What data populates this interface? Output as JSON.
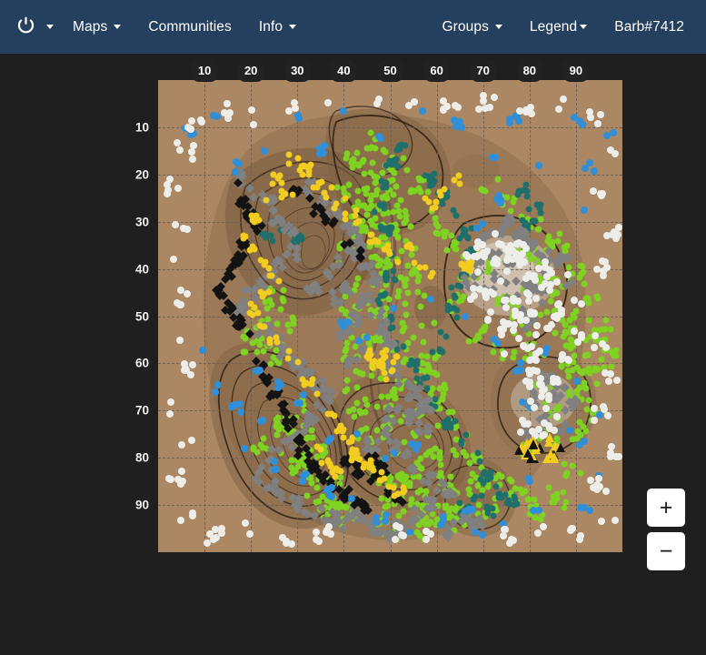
{
  "navbar": {
    "brand": {
      "icon": "ark-power-logo-icon",
      "caret_icon": "caret-down-icon"
    },
    "left_items": [
      {
        "label": "Maps",
        "has_caret": true,
        "name": "nav-maps"
      },
      {
        "label": "Communities",
        "has_caret": false,
        "name": "nav-communities"
      },
      {
        "label": "Info",
        "has_caret": true,
        "name": "nav-info"
      }
    ],
    "right_items": [
      {
        "label": "Groups",
        "has_caret": true,
        "name": "nav-groups"
      },
      {
        "label": "Legend",
        "has_caret": true,
        "name": "nav-legend"
      },
      {
        "label": "Barb#7412",
        "has_caret": false,
        "name": "nav-user"
      }
    ],
    "background_color": "#25405f",
    "text_color": "#ffffff"
  },
  "map": {
    "name": "resource-map",
    "background_color": "#1f1f1f",
    "surface_color": "#ab8763",
    "grid_color": "#6f6155",
    "x_labels": [
      "10",
      "20",
      "30",
      "40",
      "50",
      "60",
      "70",
      "80",
      "90"
    ],
    "y_labels": [
      "10",
      "20",
      "30",
      "40",
      "50",
      "60",
      "70",
      "80",
      "90"
    ],
    "axis_min": 0,
    "axis_max": 100,
    "marker_colors": {
      "wood_green": "#7ed321",
      "forest_teal": "#1f6f6b",
      "metal_gray": "#808080",
      "stone_white": "#ededea",
      "obsidian_black": "#131313",
      "sulfur_yellow": "#f2cc1e",
      "crystal_blue": "#2f8fd8",
      "pearl_white": "#e8e5de"
    }
  },
  "zoom_controls": {
    "zoom_in_label": "+",
    "zoom_out_label": "−"
  }
}
